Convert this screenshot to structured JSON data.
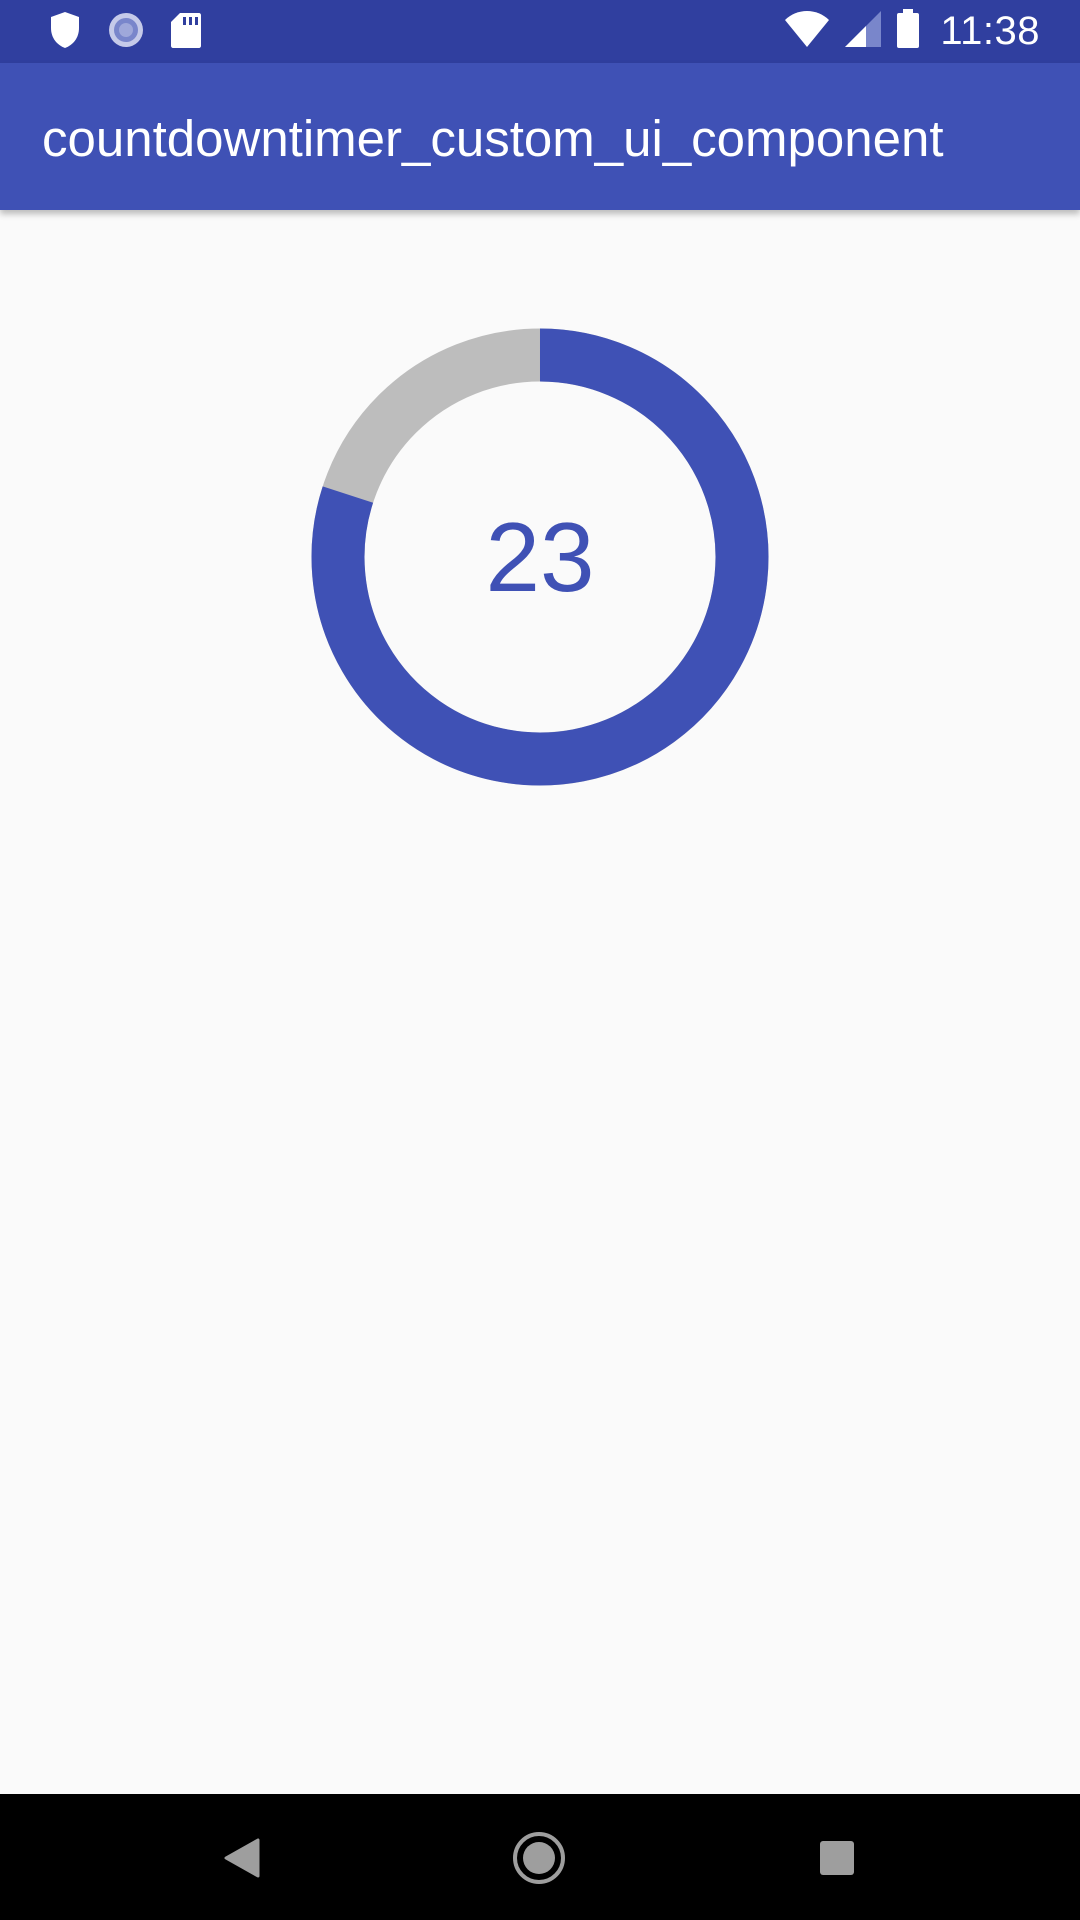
{
  "status_bar": {
    "time": "11:38",
    "icons": [
      "shield-icon",
      "sync-icon",
      "sd-card-icon",
      "wifi-icon",
      "signal-icon",
      "battery-icon"
    ]
  },
  "app_bar": {
    "title": "countdowntimer_custom_ui_component"
  },
  "timer": {
    "value": "23",
    "progress_fraction": 0.8,
    "progress_color": "#3f51b5",
    "track_color": "#bdbdbd"
  },
  "nav_bar": {
    "icons": [
      "back-icon",
      "home-icon",
      "recents-icon"
    ]
  },
  "colors": {
    "status_bar": "#303f9f",
    "app_bar": "#3f51b5",
    "background": "#fafafa"
  }
}
